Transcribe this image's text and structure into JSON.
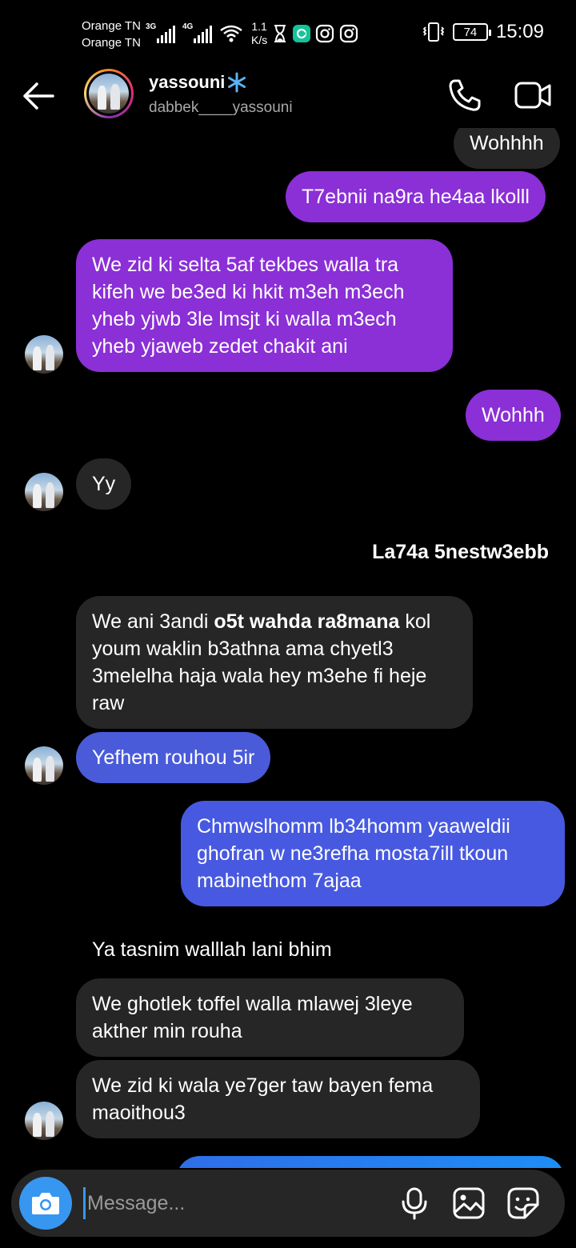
{
  "status_bar": {
    "carrier1": "Orange TN",
    "carrier2": "Orange TN",
    "net1": "3G",
    "net2": "4G",
    "speed_value": "1.1",
    "speed_unit": "K/s",
    "battery": "74",
    "time": "15:09"
  },
  "header": {
    "name": "yassouni",
    "username": "dabbek____yassouni"
  },
  "messages": [
    {
      "id": "m1",
      "side": "out",
      "text": "Wohhhh"
    },
    {
      "id": "m2",
      "side": "out",
      "text": "T7ebnii na9ra he4aa lkolll"
    },
    {
      "id": "m3",
      "side": "out",
      "text": "We zid ki selta 5af tekbes walla tra kifeh we be3ed ki hkit m3eh m3ech yheb yjwb 3le lmsjt ki walla m3ech yheb yjaweb zedet chakit ani"
    },
    {
      "id": "m4",
      "side": "out",
      "text": "Wohhh"
    },
    {
      "id": "m5",
      "side": "in",
      "text": "Yy"
    },
    {
      "id": "m6",
      "side": "divider",
      "text": "La74a 5nestw3ebb"
    },
    {
      "id": "m7",
      "side": "in",
      "text_before": "We ani 3andi ",
      "text_bold": "o5t wahda ra8mana",
      "text_after": " kol youm waklin b3athna ama chyetl3 3melelha haja wala hey m3ehe fi heje raw"
    },
    {
      "id": "m8",
      "side": "in",
      "text": "Yefhem rouhou 5ir"
    },
    {
      "id": "m9",
      "side": "out",
      "text": "Chmwslhomm lb34homm yaaweldii ghofran w ne3refha mosta7ill tkoun mabinethom 7ajaa"
    },
    {
      "id": "m10",
      "side": "in",
      "text": "Ya tasnim walllah lani bhim"
    },
    {
      "id": "m11",
      "side": "in",
      "text": "We ghotlek toffel walla mlawej 3leye akther min rouha"
    },
    {
      "id": "m12",
      "side": "in",
      "text": "We zid ki wala ye7ger taw bayen fema maoithou3"
    }
  ],
  "composer": {
    "placeholder": "Message..."
  },
  "colors": {
    "outgoing_purple": "#8b2fd6",
    "outgoing_blue": "#4a3fe0",
    "incoming": "#262626",
    "incoming_blue": "#4a5bd9",
    "accent": "#3797f0"
  }
}
